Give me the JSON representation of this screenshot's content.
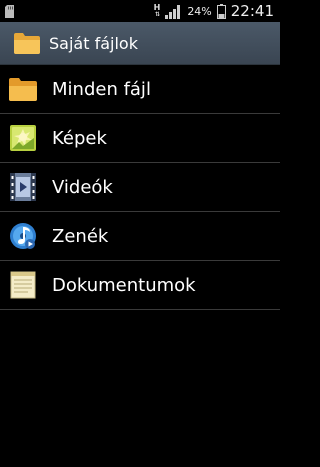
{
  "statusbar": {
    "h_indicator": "H",
    "battery_percent": "24%",
    "time": "22:41",
    "icons": [
      "sd-card-icon",
      "h-data-icon",
      "signal-icon",
      "battery-icon"
    ]
  },
  "header": {
    "title": "Saját fájlok",
    "icon": "folder-icon"
  },
  "items": [
    {
      "label": "Minden fájl",
      "icon": "folder-icon"
    },
    {
      "label": "Képek",
      "icon": "image-icon"
    },
    {
      "label": "Videók",
      "icon": "video-icon"
    },
    {
      "label": "Zenék",
      "icon": "music-icon"
    },
    {
      "label": "Dokumentumok",
      "icon": "document-icon"
    }
  ],
  "colors": {
    "background": "#000000",
    "titlebar": "#434f5d",
    "divider": "#3a3a3a",
    "folder": "#f0b040"
  }
}
